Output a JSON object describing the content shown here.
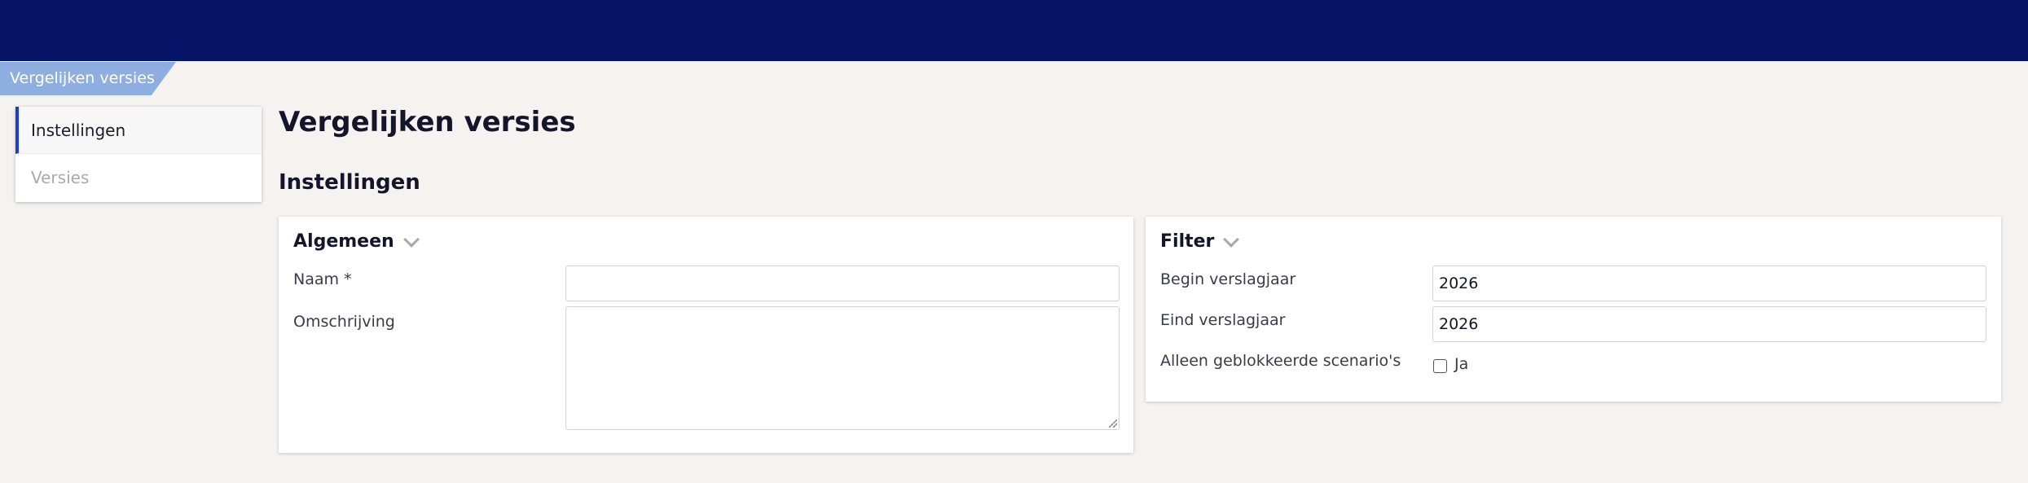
{
  "breadcrumb": {
    "label": "Vergelijken versies"
  },
  "sidebar": {
    "items": [
      {
        "label": "Instellingen",
        "active": true
      },
      {
        "label": "Versies",
        "active": false
      }
    ]
  },
  "main": {
    "title": "Vergelijken versies",
    "section_title": "Instellingen"
  },
  "panels": {
    "algemeen": {
      "title": "Algemeen",
      "fields": {
        "naam": {
          "label": "Naam *",
          "value": ""
        },
        "omschrijving": {
          "label": "Omschrijving",
          "value": ""
        }
      }
    },
    "filter": {
      "title": "Filter",
      "fields": {
        "begin": {
          "label": "Begin verslagjaar",
          "value": "2026"
        },
        "eind": {
          "label": "Eind verslagjaar",
          "value": "2026"
        },
        "geblokkeerd": {
          "label": "Alleen geblokkeerde scenario's",
          "option_label": "Ja",
          "checked": false
        }
      }
    }
  },
  "colors": {
    "topbar": "#061467",
    "breadcrumb": "#8eaee0",
    "active_accent": "#1b3bd6",
    "background": "#f5f2ef"
  }
}
